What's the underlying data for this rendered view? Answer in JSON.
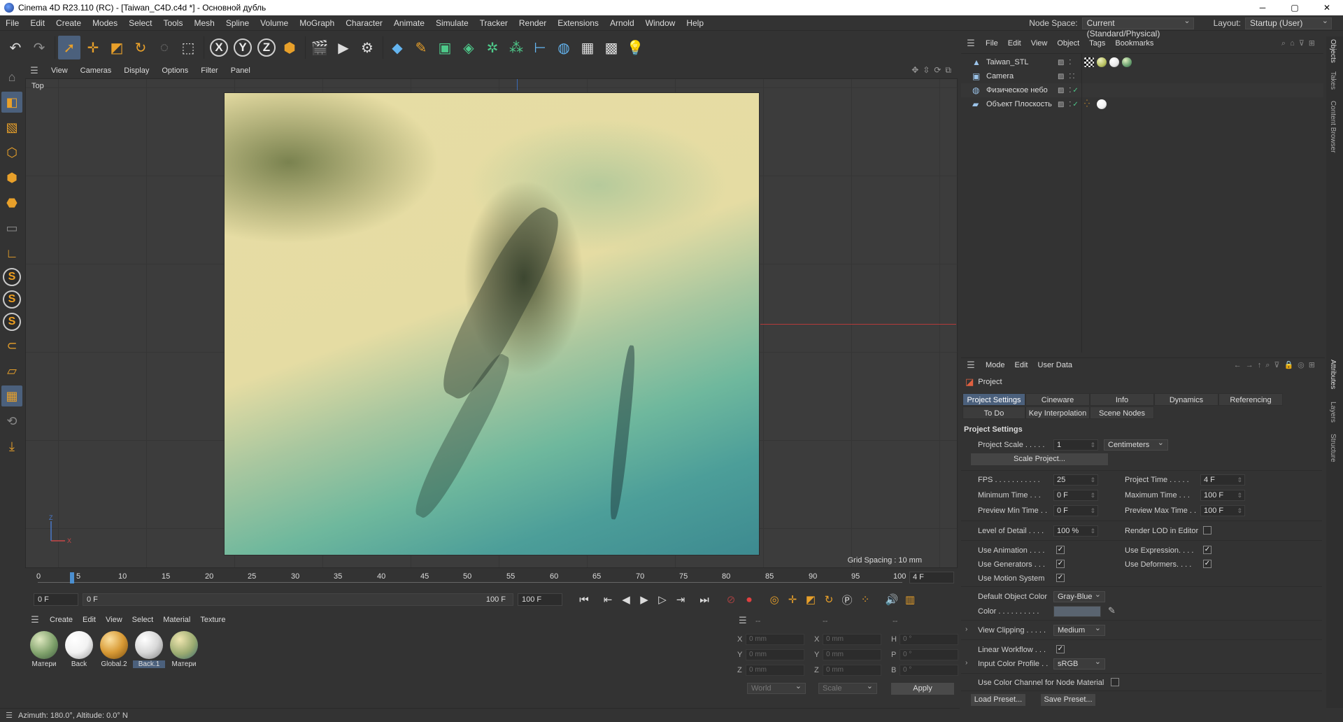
{
  "window": {
    "title": "Cinema 4D R23.110 (RC) - [Taiwan_C4D.c4d *] - Основной дубль",
    "controls": [
      "─",
      "▢",
      "✕"
    ]
  },
  "menubar": {
    "items": [
      "File",
      "Edit",
      "Create",
      "Modes",
      "Select",
      "Tools",
      "Mesh",
      "Spline",
      "Volume",
      "MoGraph",
      "Character",
      "Animate",
      "Simulate",
      "Tracker",
      "Render",
      "Extensions",
      "Arnold",
      "Window",
      "Help"
    ],
    "node_space_label": "Node Space:",
    "node_space_value": "Current (Standard/Physical)",
    "layout_label": "Layout:",
    "layout_value": "Startup (User)"
  },
  "viewport": {
    "menu": [
      "View",
      "Cameras",
      "Display",
      "Options",
      "Filter",
      "Panel"
    ],
    "view_name": "Top",
    "grid_spacing": "Grid Spacing : 10 mm"
  },
  "timeline": {
    "ticks": [
      "0",
      "5",
      "10",
      "15",
      "20",
      "25",
      "30",
      "35",
      "40",
      "45",
      "50",
      "55",
      "60",
      "65",
      "70",
      "75",
      "80",
      "85",
      "90",
      "95",
      "100"
    ],
    "current_frame": "4 F",
    "start": "0 F",
    "range_start": "0 F",
    "range_end": "100 F",
    "end": "100 F"
  },
  "materials": {
    "menu": [
      "Create",
      "Edit",
      "View",
      "Select",
      "Material",
      "Texture"
    ],
    "items": [
      {
        "label": "Матери",
        "color": "#7ea06a"
      },
      {
        "label": "Back",
        "color": "#f2f2f2"
      },
      {
        "label": "Global.2",
        "color": "#d89a35"
      },
      {
        "label": "Back.1",
        "color": "#d8d8d8"
      },
      {
        "label": "Матери",
        "color": "#9aaa70"
      }
    ]
  },
  "coords": {
    "header": [
      "--",
      "--",
      "--"
    ],
    "rows": [
      {
        "a": "X",
        "av": "0 mm",
        "b": "X",
        "bv": "0 mm",
        "c": "H",
        "cv": "0 °"
      },
      {
        "a": "Y",
        "av": "0 mm",
        "b": "Y",
        "bv": "0 mm",
        "c": "P",
        "cv": "0 °"
      },
      {
        "a": "Z",
        "av": "0 mm",
        "b": "Z",
        "bv": "0 mm",
        "c": "B",
        "cv": "0 °"
      }
    ],
    "world": "World",
    "scale": "Scale",
    "apply": "Apply"
  },
  "status": {
    "text": "Azimuth: 180.0°, Altitude: 0.0°  N"
  },
  "objects": {
    "menu": [
      "File",
      "Edit",
      "View",
      "Object",
      "Tags",
      "Bookmarks"
    ],
    "items": [
      {
        "name": "Taiwan_STL",
        "icon": "mesh-icon",
        "tags": [
          "#1a1a1a",
          "#b8c060",
          "#e8e8e8",
          "#6aa070"
        ]
      },
      {
        "name": "Camera",
        "icon": "camera-icon",
        "tags": []
      },
      {
        "name": "Физическое небо",
        "icon": "sky-icon",
        "tags": []
      },
      {
        "name": "Объект Плоскость",
        "icon": "plane-icon",
        "tags": [
          "#f2f2f2"
        ]
      }
    ]
  },
  "side_tabs": [
    "Objects",
    "Takes",
    "Content Browser",
    "Attributes",
    "Layers",
    "Structure"
  ],
  "attributes": {
    "menu": [
      "Mode",
      "Edit",
      "User Data"
    ],
    "header": "Project",
    "tabs_row1": [
      "Project Settings",
      "Cineware",
      "Info",
      "Dynamics",
      "Referencing"
    ],
    "tabs_row2": [
      "To Do",
      "Key Interpolation",
      "Scene Nodes"
    ],
    "section": "Project Settings",
    "project_scale_label": "Project Scale . . . . .",
    "project_scale_value": "1",
    "project_scale_unit": "Centimeters",
    "scale_project_btn": "Scale Project...",
    "fps_label": "FPS . . . . . . . . . . .",
    "fps_value": "25",
    "project_time_label": "Project Time . . . . .",
    "project_time_value": "4 F",
    "min_time_label": "Minimum Time . . .",
    "min_time_value": "0 F",
    "max_time_label": "Maximum Time . . .",
    "max_time_value": "100 F",
    "prev_min_label": "Preview Min Time . .",
    "prev_min_value": "0 F",
    "prev_max_label": "Preview Max Time . .",
    "prev_max_value": "100 F",
    "lod_label": "Level of Detail . . . .",
    "lod_value": "100 %",
    "render_lod_label": "Render LOD in Editor",
    "use_animation_label": "Use Animation . . . .",
    "use_expression_label": "Use Expression. . . .",
    "use_generators_label": "Use Generators . . .",
    "use_deformers_label": "Use Deformers. . . .",
    "use_motion_label": "Use Motion System",
    "default_obj_color_label": "Default Object Color",
    "default_obj_color_value": "Gray-Blue",
    "color_label": "Color . . . . . . . . . .",
    "view_clipping_label": "View Clipping . . . . .",
    "view_clipping_value": "Medium",
    "linear_workflow_label": "Linear Workflow . . .",
    "input_color_profile_label": "Input Color Profile . .",
    "input_color_profile_value": "sRGB",
    "use_color_channel_label": "Use Color Channel for Node Material",
    "load_preset": "Load Preset...",
    "save_preset": "Save Preset..."
  },
  "colors": {
    "accent": "#4b607c",
    "icon_orange": "#e8a02a",
    "panel_bg": "#333333"
  }
}
